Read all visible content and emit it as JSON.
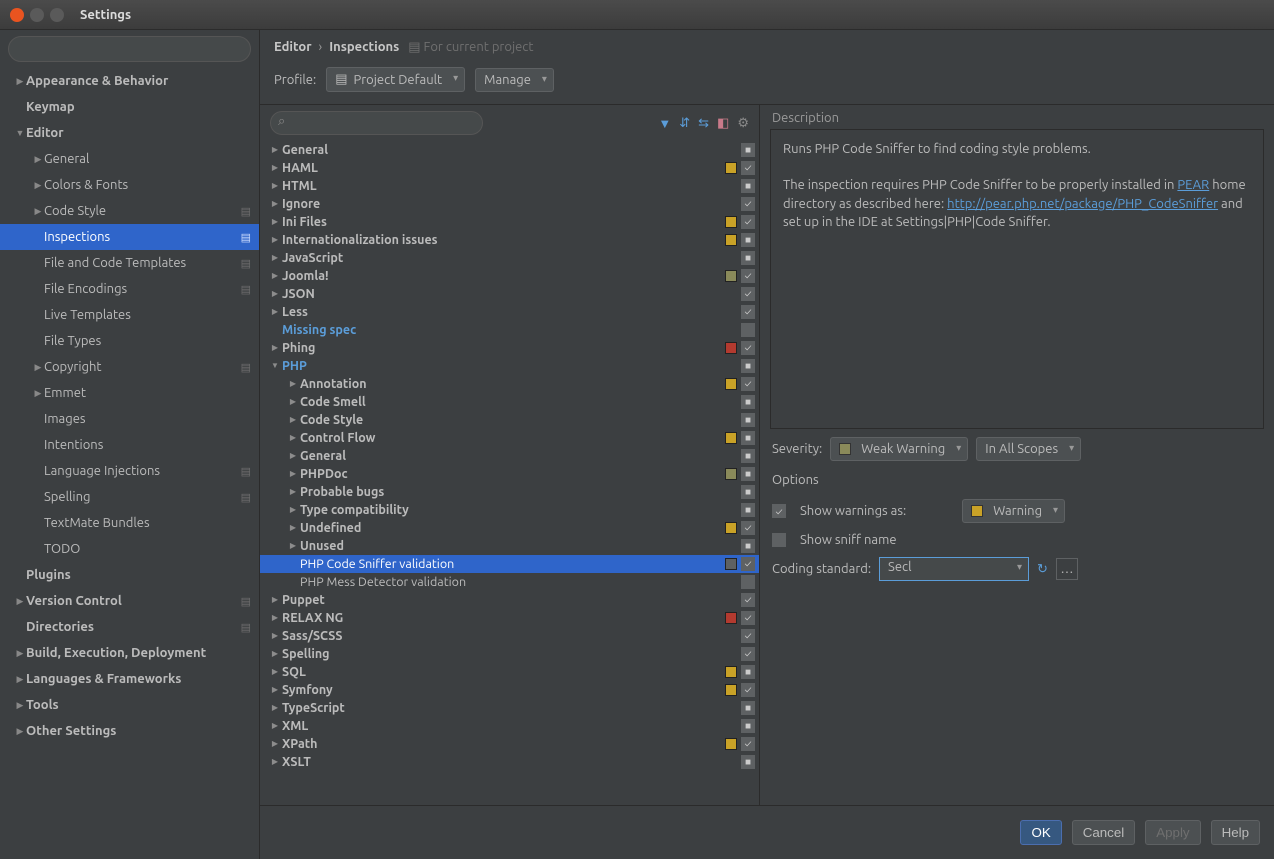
{
  "window": {
    "title": "Settings"
  },
  "sidebar": {
    "search_placeholder": "",
    "items": [
      {
        "label": "Appearance & Behavior",
        "bold": true,
        "arrow": "right",
        "indent": 0
      },
      {
        "label": "Keymap",
        "bold": true,
        "arrow": "",
        "indent": 0
      },
      {
        "label": "Editor",
        "bold": true,
        "arrow": "down",
        "indent": 0
      },
      {
        "label": "General",
        "arrow": "right",
        "indent": 1
      },
      {
        "label": "Colors & Fonts",
        "arrow": "right",
        "indent": 1
      },
      {
        "label": "Code Style",
        "arrow": "right",
        "indent": 1,
        "badge": true
      },
      {
        "label": "Inspections",
        "arrow": "",
        "indent": 1,
        "badge": true,
        "selected": true
      },
      {
        "label": "File and Code Templates",
        "arrow": "",
        "indent": 1,
        "badge": true
      },
      {
        "label": "File Encodings",
        "arrow": "",
        "indent": 1,
        "badge": true
      },
      {
        "label": "Live Templates",
        "arrow": "",
        "indent": 1
      },
      {
        "label": "File Types",
        "arrow": "",
        "indent": 1
      },
      {
        "label": "Copyright",
        "arrow": "right",
        "indent": 1,
        "badge": true
      },
      {
        "label": "Emmet",
        "arrow": "right",
        "indent": 1
      },
      {
        "label": "Images",
        "arrow": "",
        "indent": 1
      },
      {
        "label": "Intentions",
        "arrow": "",
        "indent": 1
      },
      {
        "label": "Language Injections",
        "arrow": "",
        "indent": 1,
        "badge": true
      },
      {
        "label": "Spelling",
        "arrow": "",
        "indent": 1,
        "badge": true
      },
      {
        "label": "TextMate Bundles",
        "arrow": "",
        "indent": 1
      },
      {
        "label": "TODO",
        "arrow": "",
        "indent": 1
      },
      {
        "label": "Plugins",
        "bold": true,
        "arrow": "",
        "indent": 0
      },
      {
        "label": "Version Control",
        "bold": true,
        "arrow": "right",
        "indent": 0,
        "badge": true
      },
      {
        "label": "Directories",
        "bold": true,
        "arrow": "",
        "indent": 0,
        "badge": true
      },
      {
        "label": "Build, Execution, Deployment",
        "bold": true,
        "arrow": "right",
        "indent": 0
      },
      {
        "label": "Languages & Frameworks",
        "bold": true,
        "arrow": "right",
        "indent": 0
      },
      {
        "label": "Tools",
        "bold": true,
        "arrow": "right",
        "indent": 0
      },
      {
        "label": "Other Settings",
        "bold": true,
        "arrow": "right",
        "indent": 0
      }
    ]
  },
  "breadcrumb": {
    "root": "Editor",
    "leaf": "Inspections",
    "hint": "For current project"
  },
  "profile": {
    "label": "Profile:",
    "value": "Project Default",
    "manage": "Manage"
  },
  "tree_items": [
    {
      "label": "General",
      "bold": true,
      "arrow": "right",
      "indent": 0,
      "chk": "ind"
    },
    {
      "label": "HAML",
      "bold": true,
      "arrow": "right",
      "indent": 0,
      "chk": "on",
      "swatch": "yellow"
    },
    {
      "label": "HTML",
      "bold": true,
      "arrow": "right",
      "indent": 0,
      "chk": "ind"
    },
    {
      "label": "Ignore",
      "bold": true,
      "arrow": "right",
      "indent": 0,
      "chk": "on"
    },
    {
      "label": "Ini Files",
      "bold": true,
      "arrow": "right",
      "indent": 0,
      "chk": "on",
      "swatch": "yellow"
    },
    {
      "label": "Internationalization issues",
      "bold": true,
      "arrow": "right",
      "indent": 0,
      "chk": "ind",
      "swatch": "yellow"
    },
    {
      "label": "JavaScript",
      "bold": true,
      "arrow": "right",
      "indent": 0,
      "chk": "ind"
    },
    {
      "label": "Joomla!",
      "bold": true,
      "arrow": "right",
      "indent": 0,
      "chk": "on",
      "swatch": "olive"
    },
    {
      "label": "JSON",
      "bold": true,
      "arrow": "right",
      "indent": 0,
      "chk": "on"
    },
    {
      "label": "Less",
      "bold": true,
      "arrow": "right",
      "indent": 0,
      "chk": "on"
    },
    {
      "label": "Missing spec",
      "highlight": true,
      "arrow": "",
      "indent": 0,
      "chk": "off"
    },
    {
      "label": "Phing",
      "bold": true,
      "arrow": "right",
      "indent": 0,
      "chk": "on",
      "swatch": "red"
    },
    {
      "label": "PHP",
      "highlight": true,
      "arrow": "down",
      "indent": 0,
      "chk": "ind"
    },
    {
      "label": "Annotation",
      "bold": true,
      "arrow": "right",
      "indent": 1,
      "chk": "on",
      "swatch": "yellow"
    },
    {
      "label": "Code Smell",
      "bold": true,
      "arrow": "right",
      "indent": 1,
      "chk": "ind"
    },
    {
      "label": "Code Style",
      "bold": true,
      "arrow": "right",
      "indent": 1,
      "chk": "ind"
    },
    {
      "label": "Control Flow",
      "bold": true,
      "arrow": "right",
      "indent": 1,
      "chk": "ind",
      "swatch": "yellow"
    },
    {
      "label": "General",
      "bold": true,
      "arrow": "right",
      "indent": 1,
      "chk": "ind"
    },
    {
      "label": "PHPDoc",
      "bold": true,
      "arrow": "right",
      "indent": 1,
      "chk": "ind",
      "swatch": "olive"
    },
    {
      "label": "Probable bugs",
      "bold": true,
      "arrow": "right",
      "indent": 1,
      "chk": "ind"
    },
    {
      "label": "Type compatibility",
      "bold": true,
      "arrow": "right",
      "indent": 1,
      "chk": "ind"
    },
    {
      "label": "Undefined",
      "bold": true,
      "arrow": "right",
      "indent": 1,
      "chk": "on",
      "swatch": "yellow"
    },
    {
      "label": "Unused",
      "bold": true,
      "arrow": "right",
      "indent": 1,
      "chk": "ind"
    },
    {
      "label": "PHP Code Sniffer validation",
      "arrow": "",
      "indent": 1,
      "chk": "on",
      "swatch": "gray",
      "selected": true
    },
    {
      "label": "PHP Mess Detector validation",
      "arrow": "",
      "indent": 1,
      "chk": "off"
    },
    {
      "label": "Puppet",
      "bold": true,
      "arrow": "right",
      "indent": 0,
      "chk": "on"
    },
    {
      "label": "RELAX NG",
      "bold": true,
      "arrow": "right",
      "indent": 0,
      "chk": "on",
      "swatch": "red"
    },
    {
      "label": "Sass/SCSS",
      "bold": true,
      "arrow": "right",
      "indent": 0,
      "chk": "on"
    },
    {
      "label": "Spelling",
      "bold": true,
      "arrow": "right",
      "indent": 0,
      "chk": "on"
    },
    {
      "label": "SQL",
      "bold": true,
      "arrow": "right",
      "indent": 0,
      "chk": "ind",
      "swatch": "yellow"
    },
    {
      "label": "Symfony",
      "bold": true,
      "arrow": "right",
      "indent": 0,
      "chk": "on",
      "swatch": "yellow"
    },
    {
      "label": "TypeScript",
      "bold": true,
      "arrow": "right",
      "indent": 0,
      "chk": "ind"
    },
    {
      "label": "XML",
      "bold": true,
      "arrow": "right",
      "indent": 0,
      "chk": "ind"
    },
    {
      "label": "XPath",
      "bold": true,
      "arrow": "right",
      "indent": 0,
      "chk": "on",
      "swatch": "yellow"
    },
    {
      "label": "XSLT",
      "bold": true,
      "arrow": "right",
      "indent": 0,
      "chk": "ind"
    }
  ],
  "description": {
    "title": "Description",
    "para1": "Runs PHP Code Sniffer to find coding style problems.",
    "para2a": "The inspection requires PHP Code Sniffer to be properly installed in ",
    "link1_text": "PEAR",
    "para2b": " home directory as described here: ",
    "link2_text": "http://pear.php.net/package/PHP_CodeSniffer",
    "para2c": " and set up in the IDE at Settings|PHP|Code Sniffer."
  },
  "severity": {
    "label": "Severity:",
    "value": "Weak Warning",
    "scope": "In All Scopes"
  },
  "options": {
    "title": "Options",
    "show_warnings_label": "Show warnings as:",
    "show_warnings_value": "Warning",
    "show_sniff_label": "Show sniff name",
    "coding_standard_label": "Coding standard:",
    "coding_standard_value": "Secl"
  },
  "buttons": {
    "ok": "OK",
    "cancel": "Cancel",
    "apply": "Apply",
    "help": "Help"
  }
}
